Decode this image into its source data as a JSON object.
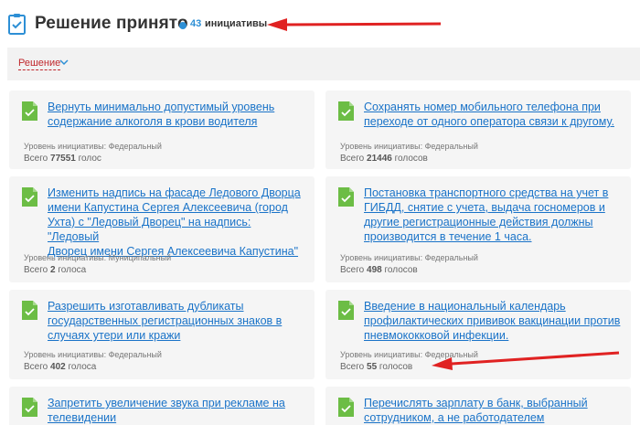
{
  "header": {
    "title": "Решение принято",
    "count": "43",
    "count_label": "инициативы"
  },
  "filter": {
    "label": "Решение"
  },
  "cards": [
    {
      "lines": [
        "Вернуть минимально допустимый уровень",
        "содержание алкоголя в крови водителя"
      ],
      "level": "Уровень инициативы: Федеральный",
      "votes_prefix": "Всего",
      "votes_num": "77551",
      "votes_suffix": "голос"
    },
    {
      "lines": [
        "Сохранять номер мобильного телефона при",
        "переходе от одного оператора связи к другому."
      ],
      "level": "Уровень инициативы: Федеральный",
      "votes_prefix": "Всего",
      "votes_num": "21446",
      "votes_suffix": "голосов"
    },
    {
      "lines": [
        "Изменить надпись на фасаде Ледового Дворца",
        "имени Капустина Сергея Алексеевича (город",
        "Ухта) с \"Ледовый Дворец\" на надпись: \"Ледовый",
        "Дворец имени Сергея Алексеевича Капустина\""
      ],
      "level": "Уровень инициативы: Муниципальный",
      "votes_prefix": "Всего",
      "votes_num": "2",
      "votes_suffix": "голоса"
    },
    {
      "lines": [
        "Постановка транспортного средства на учет в",
        "ГИБДД, снятие с учета, выдача госномеров и",
        "другие регистрационные действия должны",
        "производится в течение 1 часа."
      ],
      "level": "Уровень инициативы: Федеральный",
      "votes_prefix": "Всего",
      "votes_num": "498",
      "votes_suffix": "голосов"
    },
    {
      "lines": [
        "Разрешить изготавливать дубликаты",
        "государственных регистрационных знаков в",
        "случаях утери или кражи"
      ],
      "level": "Уровень инициативы: Федеральный",
      "votes_prefix": "Всего",
      "votes_num": "402",
      "votes_suffix": "голоса"
    },
    {
      "lines": [
        "Введение в национальный календарь",
        "профилактических прививок вакцинации против",
        "пневмококковой инфекции."
      ],
      "level": "Уровень инициативы: Федеральный",
      "votes_prefix": "Всего",
      "votes_num": "55",
      "votes_suffix": "голосов"
    },
    {
      "lines": [
        "Запретить увеличение звука при рекламе на",
        "телевидении"
      ],
      "level": "",
      "votes_prefix": "",
      "votes_num": "",
      "votes_suffix": ""
    },
    {
      "lines": [
        "Перечислять зарплату в банк, выбранный",
        "сотрудником, а не работодателем"
      ],
      "level": "",
      "votes_prefix": "",
      "votes_num": "",
      "votes_suffix": ""
    }
  ]
}
